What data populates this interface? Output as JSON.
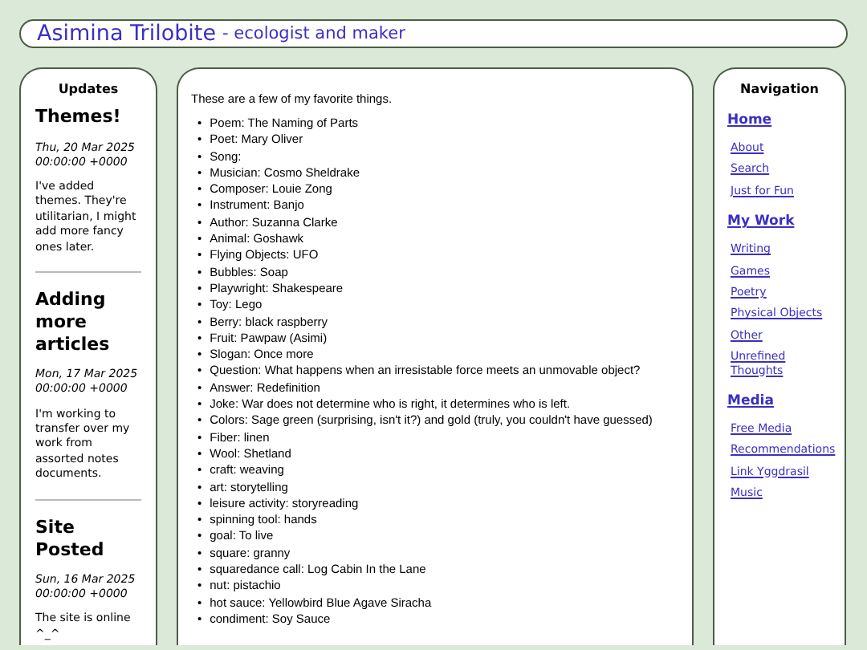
{
  "header": {
    "title": "Asimina Trilobite",
    "subtitle": "- ecologist and maker"
  },
  "updates": {
    "heading": "Updates",
    "posts": [
      {
        "title": "Themes!",
        "date": "Thu, 20 Mar 2025 00:00:00 +0000",
        "body": "I've added themes. They're utilitarian, I might add more fancy ones later."
      },
      {
        "title": "Adding more articles",
        "date": "Mon, 17 Mar 2025 00:00:00 +0000",
        "body": "I'm working to transfer over my work from assorted notes documents."
      },
      {
        "title": "Site Posted",
        "date": "Sun, 16 Mar 2025 00:00:00 +0000",
        "body": "The site is online ^_^"
      }
    ]
  },
  "content": {
    "intro": "These are a few of my favorite things.",
    "marker": "•",
    "items": [
      "Poem: The Naming of Parts",
      "Poet: Mary Oliver",
      "Song:",
      "Musician: Cosmo Sheldrake",
      "Composer: Louie Zong",
      "Instrument: Banjo",
      "Author: Suzanna Clarke",
      "Animal: Goshawk",
      "Flying Objects: UFO",
      "Bubbles: Soap",
      "Playwright: Shakespeare",
      "Toy: Lego",
      "Berry: black raspberry",
      "Fruit: Pawpaw (Asimi)",
      "Slogan: Once more",
      "Question: What happens when an irresistable force meets an unmovable object?",
      "Answer: Redefinition",
      "Joke: War does not determine who is right, it determines who is left.",
      "Colors: Sage green (surprising, isn't it?) and gold (truly, you couldn't have guessed)",
      "Fiber: linen",
      "Wool: Shetland",
      "craft: weaving",
      "art: storytelling",
      "leisure activity: storyreading",
      "spinning tool: hands",
      "goal: To live",
      "square: granny",
      "squaredance call: Log Cabin In the Lane",
      "nut: pistachio",
      "hot sauce: Yellowbird Blue Agave Siracha",
      "condiment: Soy Sauce"
    ]
  },
  "navigation": {
    "heading": "Navigation",
    "sections": [
      {
        "title": "Home",
        "links": [
          "About",
          "Search",
          "Just for Fun"
        ]
      },
      {
        "title": "My Work",
        "links": [
          "Writing",
          "Games",
          "Poetry",
          "Physical Objects",
          "Other",
          "Unrefined Thoughts"
        ]
      },
      {
        "title": "Media",
        "links": [
          "Free Media",
          "Recommendations",
          "Link Yggdrasil",
          "Music"
        ]
      }
    ]
  }
}
